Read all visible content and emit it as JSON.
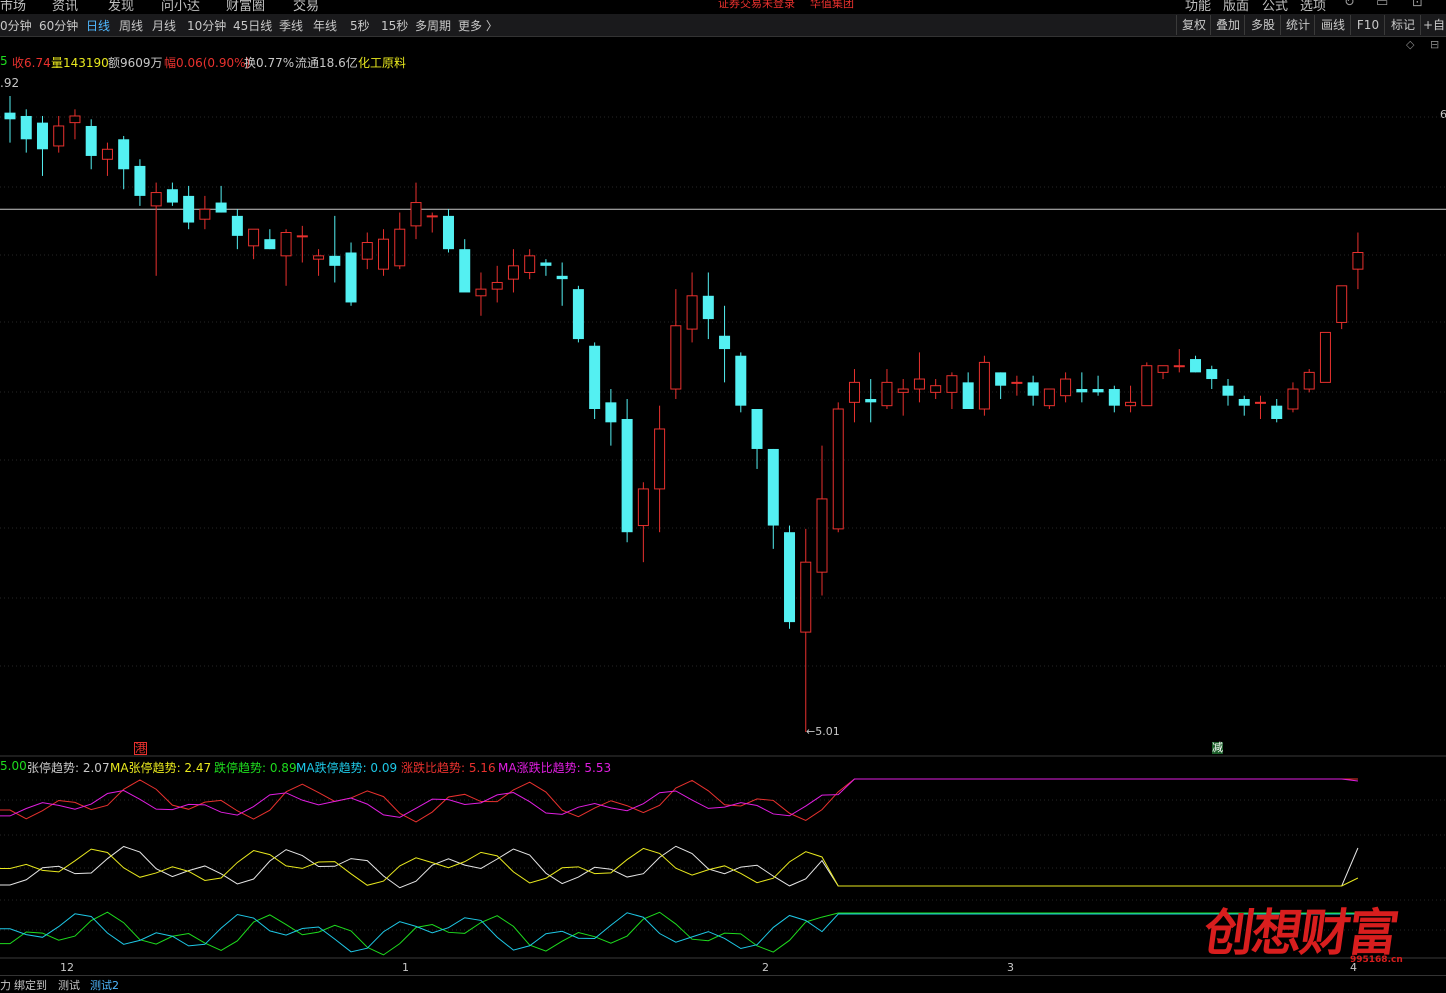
{
  "menubar": {
    "left": [
      "市场",
      "资讯",
      "发现",
      "问小达",
      "财富圈",
      "交易"
    ],
    "alert": "证券交易未登录",
    "alert2": "华值集团",
    "right": [
      "功能",
      "版面",
      "公式",
      "选项"
    ]
  },
  "period_tabs": [
    "0分钟",
    "60分钟",
    "日线",
    "周线",
    "月线",
    "10分钟",
    "45日线",
    "季线",
    "年线",
    "5秒",
    "15秒",
    "多周期",
    "更多 〉"
  ],
  "active_period": "日线",
  "toolbar": [
    "复权",
    "叠加",
    "多股",
    "统计",
    "画线",
    "F10",
    "标记",
    "+自"
  ],
  "quote": {
    "open_label": "5",
    "close": "收6.74",
    "volume": "量143190",
    "amount": "额9609万",
    "change": "幅0.06(0.90%)",
    "turnover": "换0.77%",
    "float": "流通18.6亿",
    "sector": "化工原料"
  },
  "price_labels": {
    "high": ".92",
    "low": "←5.01",
    "right_axis": "6"
  },
  "markers": {
    "hk": "港",
    "reduce": "减"
  },
  "indicator_legend": {
    "lead": "5.00",
    "zt": "张停趋势: 2.07",
    "ma_zt": "MA张停趋势: 2.47",
    "dt": "跌停趋势: 0.89",
    "ma_dt": "MA跌停趋势: 0.09",
    "ratio": "涨跌比趋势: 5.16",
    "ma_ratio": "MA涨跌比趋势: 5.53"
  },
  "x_axis_labels": [
    "12",
    "1",
    "2",
    "3",
    "4"
  ],
  "bottom_tabs": [
    "力",
    "绑定到",
    "测试",
    "测试2"
  ],
  "active_bottom_tab": "测试2",
  "watermark": {
    "text": "创想财富",
    "url": "995168.cn"
  },
  "colors": {
    "up": "#e8312e",
    "down": "#54f0f2",
    "accent": "#4fb8ff",
    "yellow": "#e8e81e",
    "magenta": "#e01ee0",
    "green": "#1edc1e",
    "cyan": "#1ec8e6"
  },
  "chart_data": {
    "type": "candlestick",
    "title": "",
    "ohlc_note": "approximate, price units (CNY)",
    "candles": [
      {
        "o": 6.87,
        "h": 6.92,
        "l": 6.78,
        "c": 6.85
      },
      {
        "o": 6.86,
        "h": 6.88,
        "l": 6.75,
        "c": 6.79
      },
      {
        "o": 6.84,
        "h": 6.86,
        "l": 6.68,
        "c": 6.76
      },
      {
        "o": 6.77,
        "h": 6.86,
        "l": 6.75,
        "c": 6.83
      },
      {
        "o": 6.84,
        "h": 6.88,
        "l": 6.79,
        "c": 6.86
      },
      {
        "o": 6.83,
        "h": 6.85,
        "l": 6.7,
        "c": 6.74
      },
      {
        "o": 6.73,
        "h": 6.78,
        "l": 6.68,
        "c": 6.76
      },
      {
        "o": 6.79,
        "h": 6.8,
        "l": 6.64,
        "c": 6.7
      },
      {
        "o": 6.71,
        "h": 6.73,
        "l": 6.59,
        "c": 6.62
      },
      {
        "o": 6.59,
        "h": 6.66,
        "l": 6.38,
        "c": 6.63
      },
      {
        "o": 6.64,
        "h": 6.66,
        "l": 6.59,
        "c": 6.6
      },
      {
        "o": 6.62,
        "h": 6.65,
        "l": 6.52,
        "c": 6.54
      },
      {
        "o": 6.55,
        "h": 6.62,
        "l": 6.52,
        "c": 6.58
      },
      {
        "o": 6.6,
        "h": 6.65,
        "l": 6.57,
        "c": 6.57
      },
      {
        "o": 6.56,
        "h": 6.58,
        "l": 6.46,
        "c": 6.5
      },
      {
        "o": 6.47,
        "h": 6.52,
        "l": 6.43,
        "c": 6.52
      },
      {
        "o": 6.49,
        "h": 6.52,
        "l": 6.46,
        "c": 6.46
      },
      {
        "o": 6.44,
        "h": 6.52,
        "l": 6.35,
        "c": 6.51
      },
      {
        "o": 6.5,
        "h": 6.53,
        "l": 6.42,
        "c": 6.5
      },
      {
        "o": 6.43,
        "h": 6.46,
        "l": 6.38,
        "c": 6.44
      },
      {
        "o": 6.44,
        "h": 6.56,
        "l": 6.36,
        "c": 6.41
      },
      {
        "o": 6.45,
        "h": 6.48,
        "l": 6.29,
        "c": 6.3
      },
      {
        "o": 6.43,
        "h": 6.51,
        "l": 6.4,
        "c": 6.48
      },
      {
        "o": 6.4,
        "h": 6.52,
        "l": 6.38,
        "c": 6.49
      },
      {
        "o": 6.41,
        "h": 6.57,
        "l": 6.4,
        "c": 6.52
      },
      {
        "o": 6.53,
        "h": 6.66,
        "l": 6.49,
        "c": 6.6
      },
      {
        "o": 6.56,
        "h": 6.57,
        "l": 6.51,
        "c": 6.56
      },
      {
        "o": 6.56,
        "h": 6.58,
        "l": 6.45,
        "c": 6.46
      },
      {
        "o": 6.46,
        "h": 6.49,
        "l": 6.34,
        "c": 6.33
      },
      {
        "o": 6.32,
        "h": 6.39,
        "l": 6.26,
        "c": 6.34
      },
      {
        "o": 6.34,
        "h": 6.41,
        "l": 6.3,
        "c": 6.36
      },
      {
        "o": 6.37,
        "h": 6.46,
        "l": 6.33,
        "c": 6.41
      },
      {
        "o": 6.39,
        "h": 6.46,
        "l": 6.37,
        "c": 6.44
      },
      {
        "o": 6.42,
        "h": 6.43,
        "l": 6.38,
        "c": 6.41
      },
      {
        "o": 6.38,
        "h": 6.42,
        "l": 6.29,
        "c": 6.37
      },
      {
        "o": 6.34,
        "h": 6.35,
        "l": 6.18,
        "c": 6.19
      },
      {
        "o": 6.17,
        "h": 6.18,
        "l": 5.95,
        "c": 5.98
      },
      {
        "o": 6.0,
        "h": 6.04,
        "l": 5.87,
        "c": 5.94
      },
      {
        "o": 5.95,
        "h": 6.01,
        "l": 5.58,
        "c": 5.61
      },
      {
        "o": 5.63,
        "h": 5.76,
        "l": 5.52,
        "c": 5.74
      },
      {
        "o": 5.74,
        "h": 5.99,
        "l": 5.61,
        "c": 5.92
      },
      {
        "o": 6.04,
        "h": 6.34,
        "l": 6.01,
        "c": 6.23
      },
      {
        "o": 6.22,
        "h": 6.39,
        "l": 6.18,
        "c": 6.32
      },
      {
        "o": 6.32,
        "h": 6.39,
        "l": 6.19,
        "c": 6.25
      },
      {
        "o": 6.2,
        "h": 6.29,
        "l": 6.06,
        "c": 6.16
      },
      {
        "o": 6.14,
        "h": 6.15,
        "l": 5.97,
        "c": 5.99
      },
      {
        "o": 5.98,
        "h": 5.98,
        "l": 5.8,
        "c": 5.86
      },
      {
        "o": 5.86,
        "h": 5.86,
        "l": 5.56,
        "c": 5.63
      },
      {
        "o": 5.61,
        "h": 5.63,
        "l": 5.32,
        "c": 5.34
      },
      {
        "o": 5.31,
        "h": 5.62,
        "l": 5.01,
        "c": 5.52
      },
      {
        "o": 5.49,
        "h": 5.87,
        "l": 5.42,
        "c": 5.71
      },
      {
        "o": 5.62,
        "h": 6.0,
        "l": 5.61,
        "c": 5.98
      },
      {
        "o": 6.0,
        "h": 6.1,
        "l": 5.94,
        "c": 6.06
      },
      {
        "o": 6.01,
        "h": 6.07,
        "l": 5.94,
        "c": 6.0
      },
      {
        "o": 5.99,
        "h": 6.1,
        "l": 5.98,
        "c": 6.06
      },
      {
        "o": 6.03,
        "h": 6.07,
        "l": 5.96,
        "c": 6.04
      },
      {
        "o": 6.04,
        "h": 6.15,
        "l": 6.0,
        "c": 6.07
      },
      {
        "o": 6.03,
        "h": 6.07,
        "l": 6.01,
        "c": 6.05
      },
      {
        "o": 6.03,
        "h": 6.09,
        "l": 5.98,
        "c": 6.08
      },
      {
        "o": 6.06,
        "h": 6.09,
        "l": 5.99,
        "c": 5.98
      },
      {
        "o": 5.98,
        "h": 6.14,
        "l": 5.96,
        "c": 6.12
      },
      {
        "o": 6.09,
        "h": 6.09,
        "l": 6.01,
        "c": 6.05
      },
      {
        "o": 6.06,
        "h": 6.08,
        "l": 6.02,
        "c": 6.06
      },
      {
        "o": 6.06,
        "h": 6.08,
        "l": 5.99,
        "c": 6.02
      },
      {
        "o": 5.99,
        "h": 6.04,
        "l": 5.98,
        "c": 6.04
      },
      {
        "o": 6.02,
        "h": 6.09,
        "l": 6.0,
        "c": 6.07
      },
      {
        "o": 6.04,
        "h": 6.09,
        "l": 6.0,
        "c": 6.03
      },
      {
        "o": 6.04,
        "h": 6.08,
        "l": 6.02,
        "c": 6.03
      },
      {
        "o": 6.04,
        "h": 6.05,
        "l": 5.97,
        "c": 5.99
      },
      {
        "o": 5.99,
        "h": 6.05,
        "l": 5.97,
        "c": 6.0
      },
      {
        "o": 5.99,
        "h": 6.12,
        "l": 5.99,
        "c": 6.11
      },
      {
        "o": 6.09,
        "h": 6.11,
        "l": 6.07,
        "c": 6.11
      },
      {
        "o": 6.11,
        "h": 6.16,
        "l": 6.09,
        "c": 6.11
      },
      {
        "o": 6.13,
        "h": 6.14,
        "l": 6.09,
        "c": 6.09
      },
      {
        "o": 6.1,
        "h": 6.11,
        "l": 6.04,
        "c": 6.07
      },
      {
        "o": 6.05,
        "h": 6.07,
        "l": 5.99,
        "c": 6.02
      },
      {
        "o": 6.01,
        "h": 6.02,
        "l": 5.96,
        "c": 5.99
      },
      {
        "o": 6.0,
        "h": 6.02,
        "l": 5.95,
        "c": 6.0
      },
      {
        "o": 5.99,
        "h": 6.01,
        "l": 5.94,
        "c": 5.95
      },
      {
        "o": 5.98,
        "h": 6.06,
        "l": 5.97,
        "c": 6.04
      },
      {
        "o": 6.04,
        "h": 6.1,
        "l": 6.03,
        "c": 6.09
      },
      {
        "o": 6.06,
        "h": 6.21,
        "l": 6.06,
        "c": 6.21
      },
      {
        "o": 6.24,
        "h": 6.34,
        "l": 6.22,
        "c": 6.35
      },
      {
        "o": 6.4,
        "h": 6.51,
        "l": 6.34,
        "c": 6.45
      }
    ],
    "ylim": [
      5.01,
      6.92
    ],
    "x_ticks": [
      "12",
      "1",
      "2",
      "3",
      "4"
    ],
    "reference_line": 6.58
  }
}
